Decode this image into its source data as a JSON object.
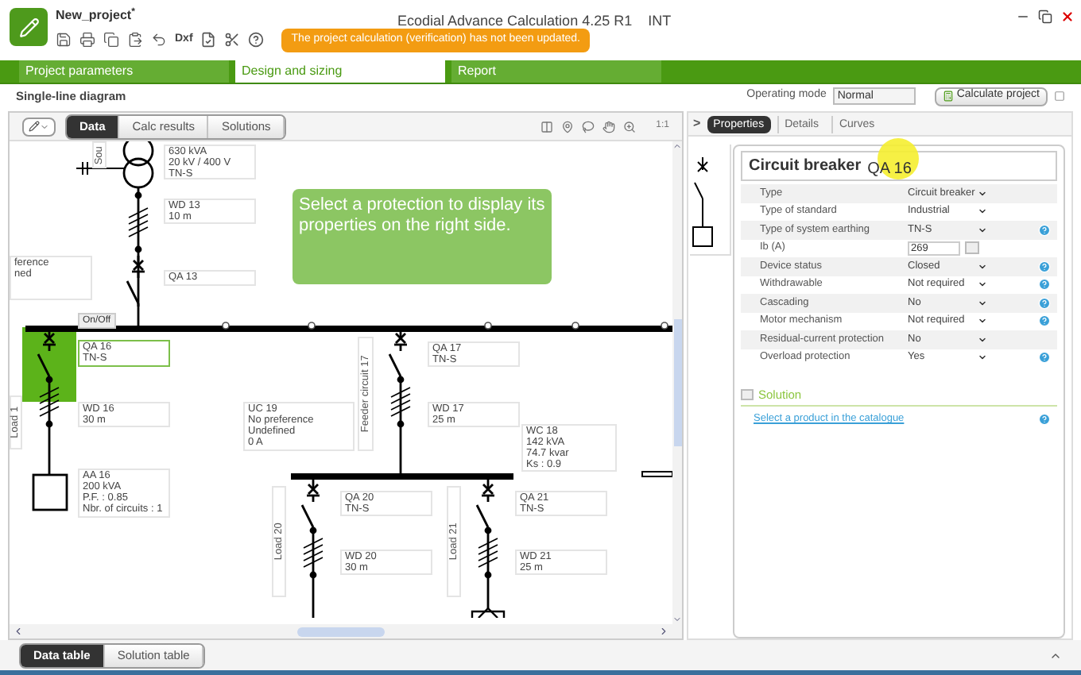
{
  "window": {
    "project": "New_project",
    "modified_mark": "*",
    "title": "Ecodial Advance Calculation 4.25 R1",
    "edition": "INT"
  },
  "toolbar": {
    "dxf": "Dxf",
    "warning": "The project calculation (verification) has not been updated."
  },
  "main_tabs": [
    {
      "label": "Project parameters",
      "selected": false
    },
    {
      "label": "Design and sizing",
      "selected": true
    },
    {
      "label": "Report",
      "selected": false
    }
  ],
  "section_title": "Single-line diagram",
  "operating_mode": {
    "label": "Operating mode",
    "value": "Normal"
  },
  "calculate_button": "Calculate project",
  "diagram_toolbar": {
    "view_tabs": [
      {
        "label": "Data",
        "selected": true
      },
      {
        "label": "Calc results",
        "selected": false
      },
      {
        "label": "Solutions",
        "selected": false
      }
    ],
    "zoom_label": "1:1"
  },
  "diagram": {
    "on_off": "On/Off",
    "message": "Select a protection to display its properties on the right side.",
    "labels": [
      {
        "lines": [
          "630 kVA",
          "20 kV / 400 V",
          "TN-S"
        ],
        "selected": false
      },
      {
        "lines": [
          "WD 13",
          "10 m"
        ],
        "selected": false
      },
      {
        "lines": [
          "QA 13"
        ],
        "selected": false
      },
      {
        "lines": [
          "ference",
          "ned"
        ],
        "selected": false
      },
      {
        "lines": [
          "QA 16",
          "TN-S"
        ],
        "selected": true
      },
      {
        "lines": [
          "WD 16",
          "30 m"
        ],
        "selected": false
      },
      {
        "lines": [
          "AA 16",
          "200 kVA",
          "P.F. : 0.85",
          "Nbr. of circuits : 1"
        ],
        "selected": false
      },
      {
        "lines": [
          "UC 19",
          "No preference",
          "Undefined",
          "0 A"
        ],
        "selected": false
      },
      {
        "lines": [
          "QA 17",
          "TN-S"
        ],
        "selected": false
      },
      {
        "lines": [
          "WD 17",
          "25 m"
        ],
        "selected": false
      },
      {
        "lines": [
          "WC 18",
          "142 kVA",
          "74.7 kvar",
          "Ks : 0.9"
        ],
        "selected": false
      },
      {
        "lines": [
          "QA 20",
          "TN-S"
        ],
        "selected": false
      },
      {
        "lines": [
          "WD 20",
          "30 m"
        ],
        "selected": false
      },
      {
        "lines": [
          "QA 21",
          "TN-S"
        ],
        "selected": false
      },
      {
        "lines": [
          "WD 21",
          "25 m"
        ],
        "selected": false
      }
    ],
    "vertical_labels": [
      "Sou",
      "Load 1",
      "Feeder circuit 17",
      "Load 20",
      "Load 21"
    ]
  },
  "properties_panel": {
    "expand_glyph": ">",
    "tabs": [
      {
        "label": "Properties",
        "selected": true
      },
      {
        "label": "Details",
        "selected": false
      },
      {
        "label": "Curves",
        "selected": false
      }
    ],
    "title": "Circuit breaker",
    "reference": "QA 16",
    "rows": [
      {
        "label": "Type",
        "value": "Circuit breaker",
        "kind": "select",
        "help": false
      },
      {
        "label": "Type of standard",
        "value": "Industrial",
        "kind": "select",
        "help": false
      },
      {
        "label": "Type of system earthing",
        "value": "TN-S",
        "kind": "select",
        "help": true
      },
      {
        "label": "Ib (A)",
        "value": "269",
        "kind": "input",
        "help": false
      },
      {
        "label": "Device status",
        "value": "Closed",
        "kind": "select",
        "help": true
      },
      {
        "label": "Withdrawable",
        "value": "Not required",
        "kind": "select",
        "help": true
      },
      {
        "label": "Cascading",
        "value": "No",
        "kind": "select",
        "help": true
      },
      {
        "label": "Motor mechanism",
        "value": "Not required",
        "kind": "select",
        "help": true
      },
      {
        "label": "Residual-current protection",
        "value": "No",
        "kind": "select",
        "help": false
      },
      {
        "label": "Overload protection",
        "value": "Yes",
        "kind": "select",
        "help": true
      }
    ],
    "solution": {
      "title": "Solution",
      "link": "Select a product in the catalogue"
    }
  },
  "bottom_tabs": [
    {
      "label": "Data table",
      "selected": true
    },
    {
      "label": "Solution table",
      "selected": false
    }
  ]
}
